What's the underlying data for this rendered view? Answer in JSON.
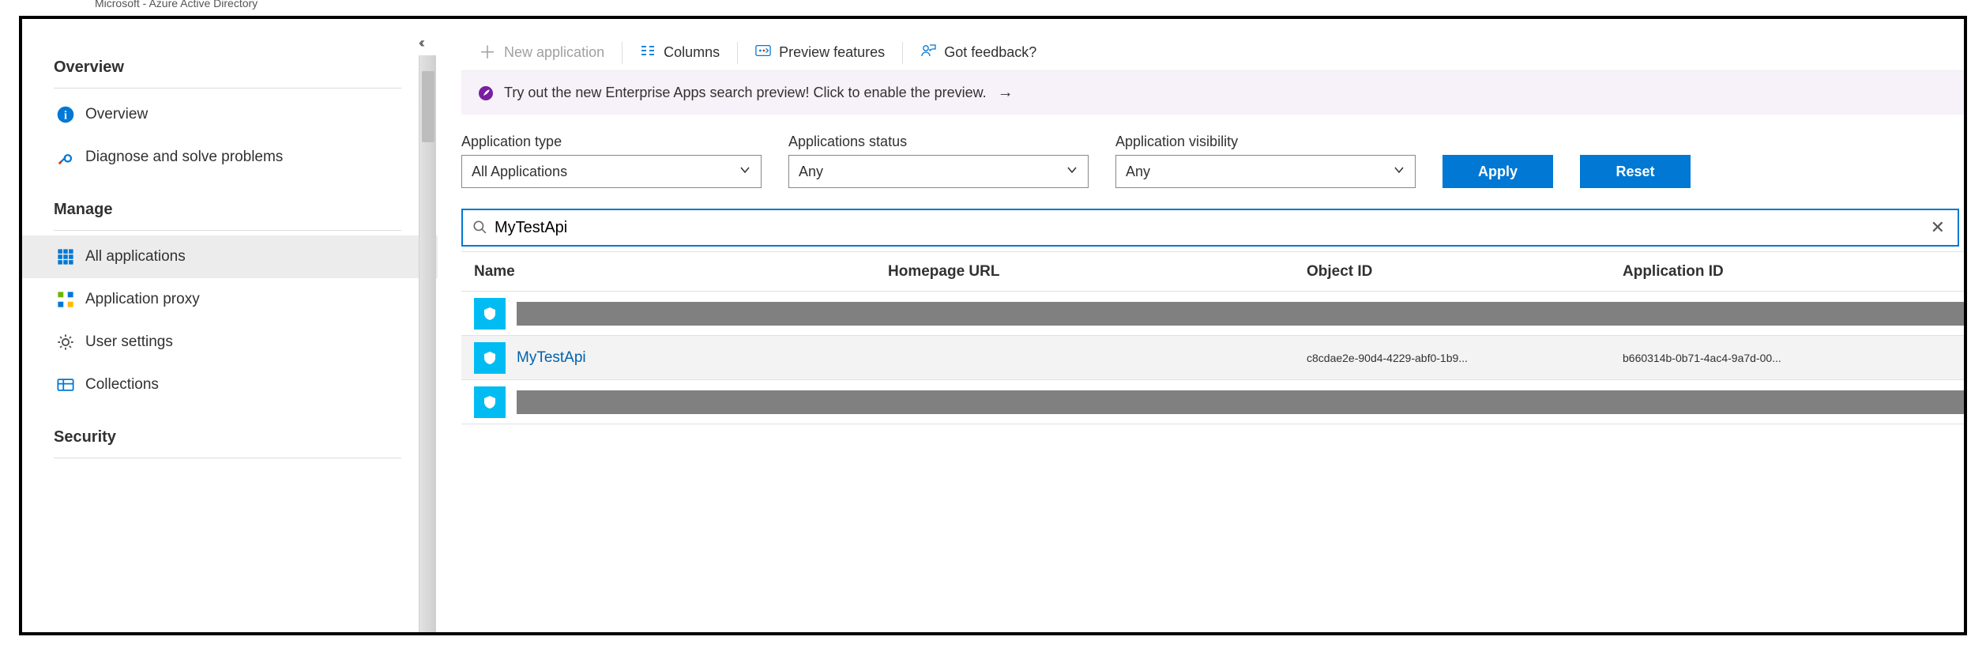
{
  "breadcrumb": "Microsoft - Azure Active Directory",
  "sidebar": {
    "sections": [
      {
        "header": "Overview",
        "items": [
          {
            "label": "Overview",
            "icon": "info"
          },
          {
            "label": "Diagnose and solve problems",
            "icon": "wrench"
          }
        ]
      },
      {
        "header": "Manage",
        "items": [
          {
            "label": "All applications",
            "icon": "grid",
            "active": true
          },
          {
            "label": "Application proxy",
            "icon": "proxy"
          },
          {
            "label": "User settings",
            "icon": "gear"
          },
          {
            "label": "Collections",
            "icon": "collections"
          }
        ]
      },
      {
        "header": "Security",
        "items": []
      }
    ]
  },
  "commandbar": {
    "new_app": "New application",
    "columns": "Columns",
    "preview": "Preview features",
    "feedback": "Got feedback?"
  },
  "banner": {
    "text": "Try out the new Enterprise Apps search preview! Click to enable the preview."
  },
  "filters": {
    "type_label": "Application type",
    "type_value": "All Applications",
    "status_label": "Applications status",
    "status_value": "Any",
    "visibility_label": "Application visibility",
    "visibility_value": "Any",
    "apply": "Apply",
    "reset": "Reset"
  },
  "search": {
    "value": "MyTestApi"
  },
  "table": {
    "headers": {
      "name": "Name",
      "homepage": "Homepage URL",
      "object_id": "Object ID",
      "app_id": "Application ID"
    },
    "rows": [
      {
        "redacted": true
      },
      {
        "redacted": false,
        "name": "MyTestApi",
        "homepage": "",
        "object_id": "c8cdae2e-90d4-4229-abf0-1b9...",
        "app_id": "b660314b-0b71-4ac4-9a7d-00..."
      },
      {
        "redacted": true
      }
    ]
  }
}
